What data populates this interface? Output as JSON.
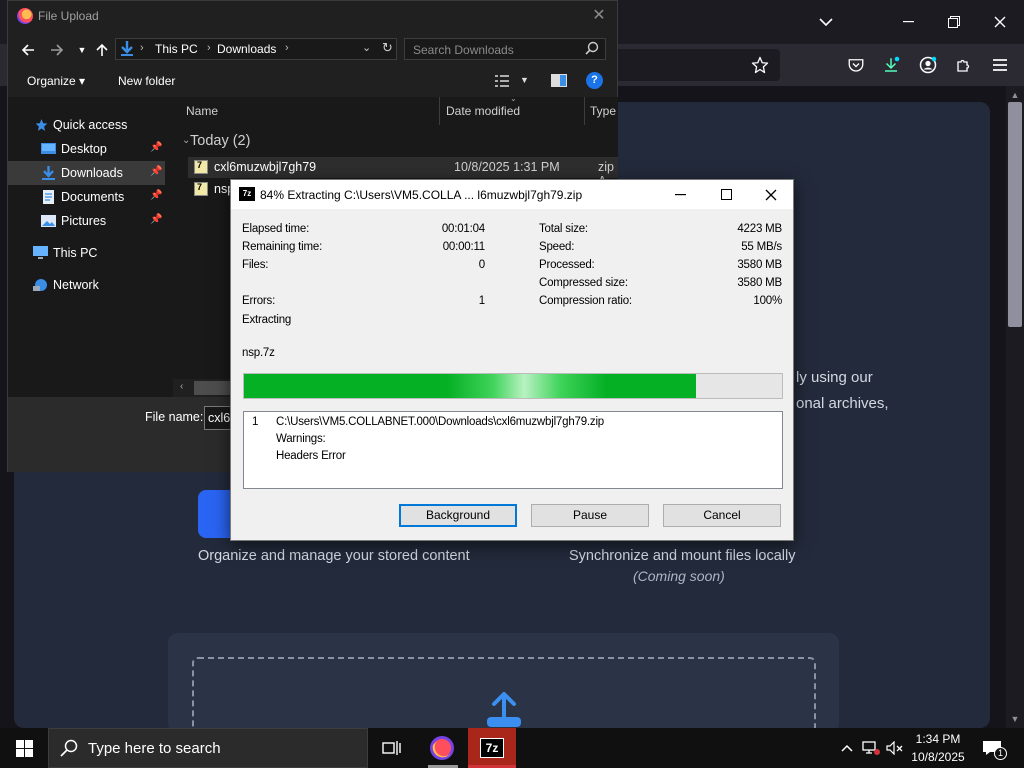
{
  "firefox": {
    "site": {
      "text_right_line1": "ly using our",
      "text_right_line2": "onal archives,",
      "card_left_caption": "Organize and manage your stored content",
      "card_right_caption": "Synchronize and mount files locally",
      "card_right_note": "(Coming soon)"
    }
  },
  "file_upload": {
    "title": "File Upload",
    "breadcrumb": [
      "This PC",
      "Downloads"
    ],
    "search_placeholder": "Search Downloads",
    "toolbar": {
      "organize": "Organize ▾",
      "new_folder": "New folder"
    },
    "nav": {
      "quick_access": "Quick access",
      "items": [
        "Desktop",
        "Downloads",
        "Documents",
        "Pictures"
      ],
      "this_pc": "This PC",
      "network": "Network"
    },
    "columns": {
      "name": "Name",
      "date": "Date modified",
      "type": "Type"
    },
    "group": "Today (2)",
    "files": [
      {
        "name": "cxl6muzwbjl7gh79",
        "date": "10/8/2025 1:31 PM",
        "type": "zip A"
      },
      {
        "name": "nsp",
        "date": "",
        "type": ""
      }
    ],
    "file_name_label": "File name:",
    "file_name_value": "cxl6m"
  },
  "sevenzip": {
    "title": "84% Extracting C:\\Users\\VM5.COLLA ... l6muzwbjl7gh79.zip",
    "progress": 0.84,
    "left_stats": {
      "elapsed_label": "Elapsed time:",
      "elapsed": "00:01:04",
      "remaining_label": "Remaining time:",
      "remaining": "00:00:11",
      "files_label": "Files:",
      "files": "0",
      "errors_label": "Errors:",
      "errors": "1",
      "status": "Extracting",
      "current_file": "nsp.7z"
    },
    "right_stats": {
      "total_label": "Total size:",
      "total": "4223 MB",
      "speed_label": "Speed:",
      "speed": "55 MB/s",
      "processed_label": "Processed:",
      "processed": "3580 MB",
      "compressed_label": "Compressed size:",
      "compressed": "3580 MB",
      "ratio_label": "Compression ratio:",
      "ratio": "100%"
    },
    "log": {
      "index": "1",
      "path": "C:\\Users\\VM5.COLLABNET.000\\Downloads\\cxl6muzwbjl7gh79.zip",
      "line2": "Warnings:",
      "line3": "Headers Error"
    },
    "buttons": {
      "background": "Background",
      "pause": "Pause",
      "cancel": "Cancel"
    }
  },
  "taskbar": {
    "search_placeholder": "Type here to search",
    "time": "1:34 PM",
    "date": "10/8/2025",
    "notification_count": "1"
  },
  "colors": {
    "progress_green": "#06b025",
    "dialog_default_border": "#0078d7",
    "site_button_blue": "#2a64f2"
  }
}
